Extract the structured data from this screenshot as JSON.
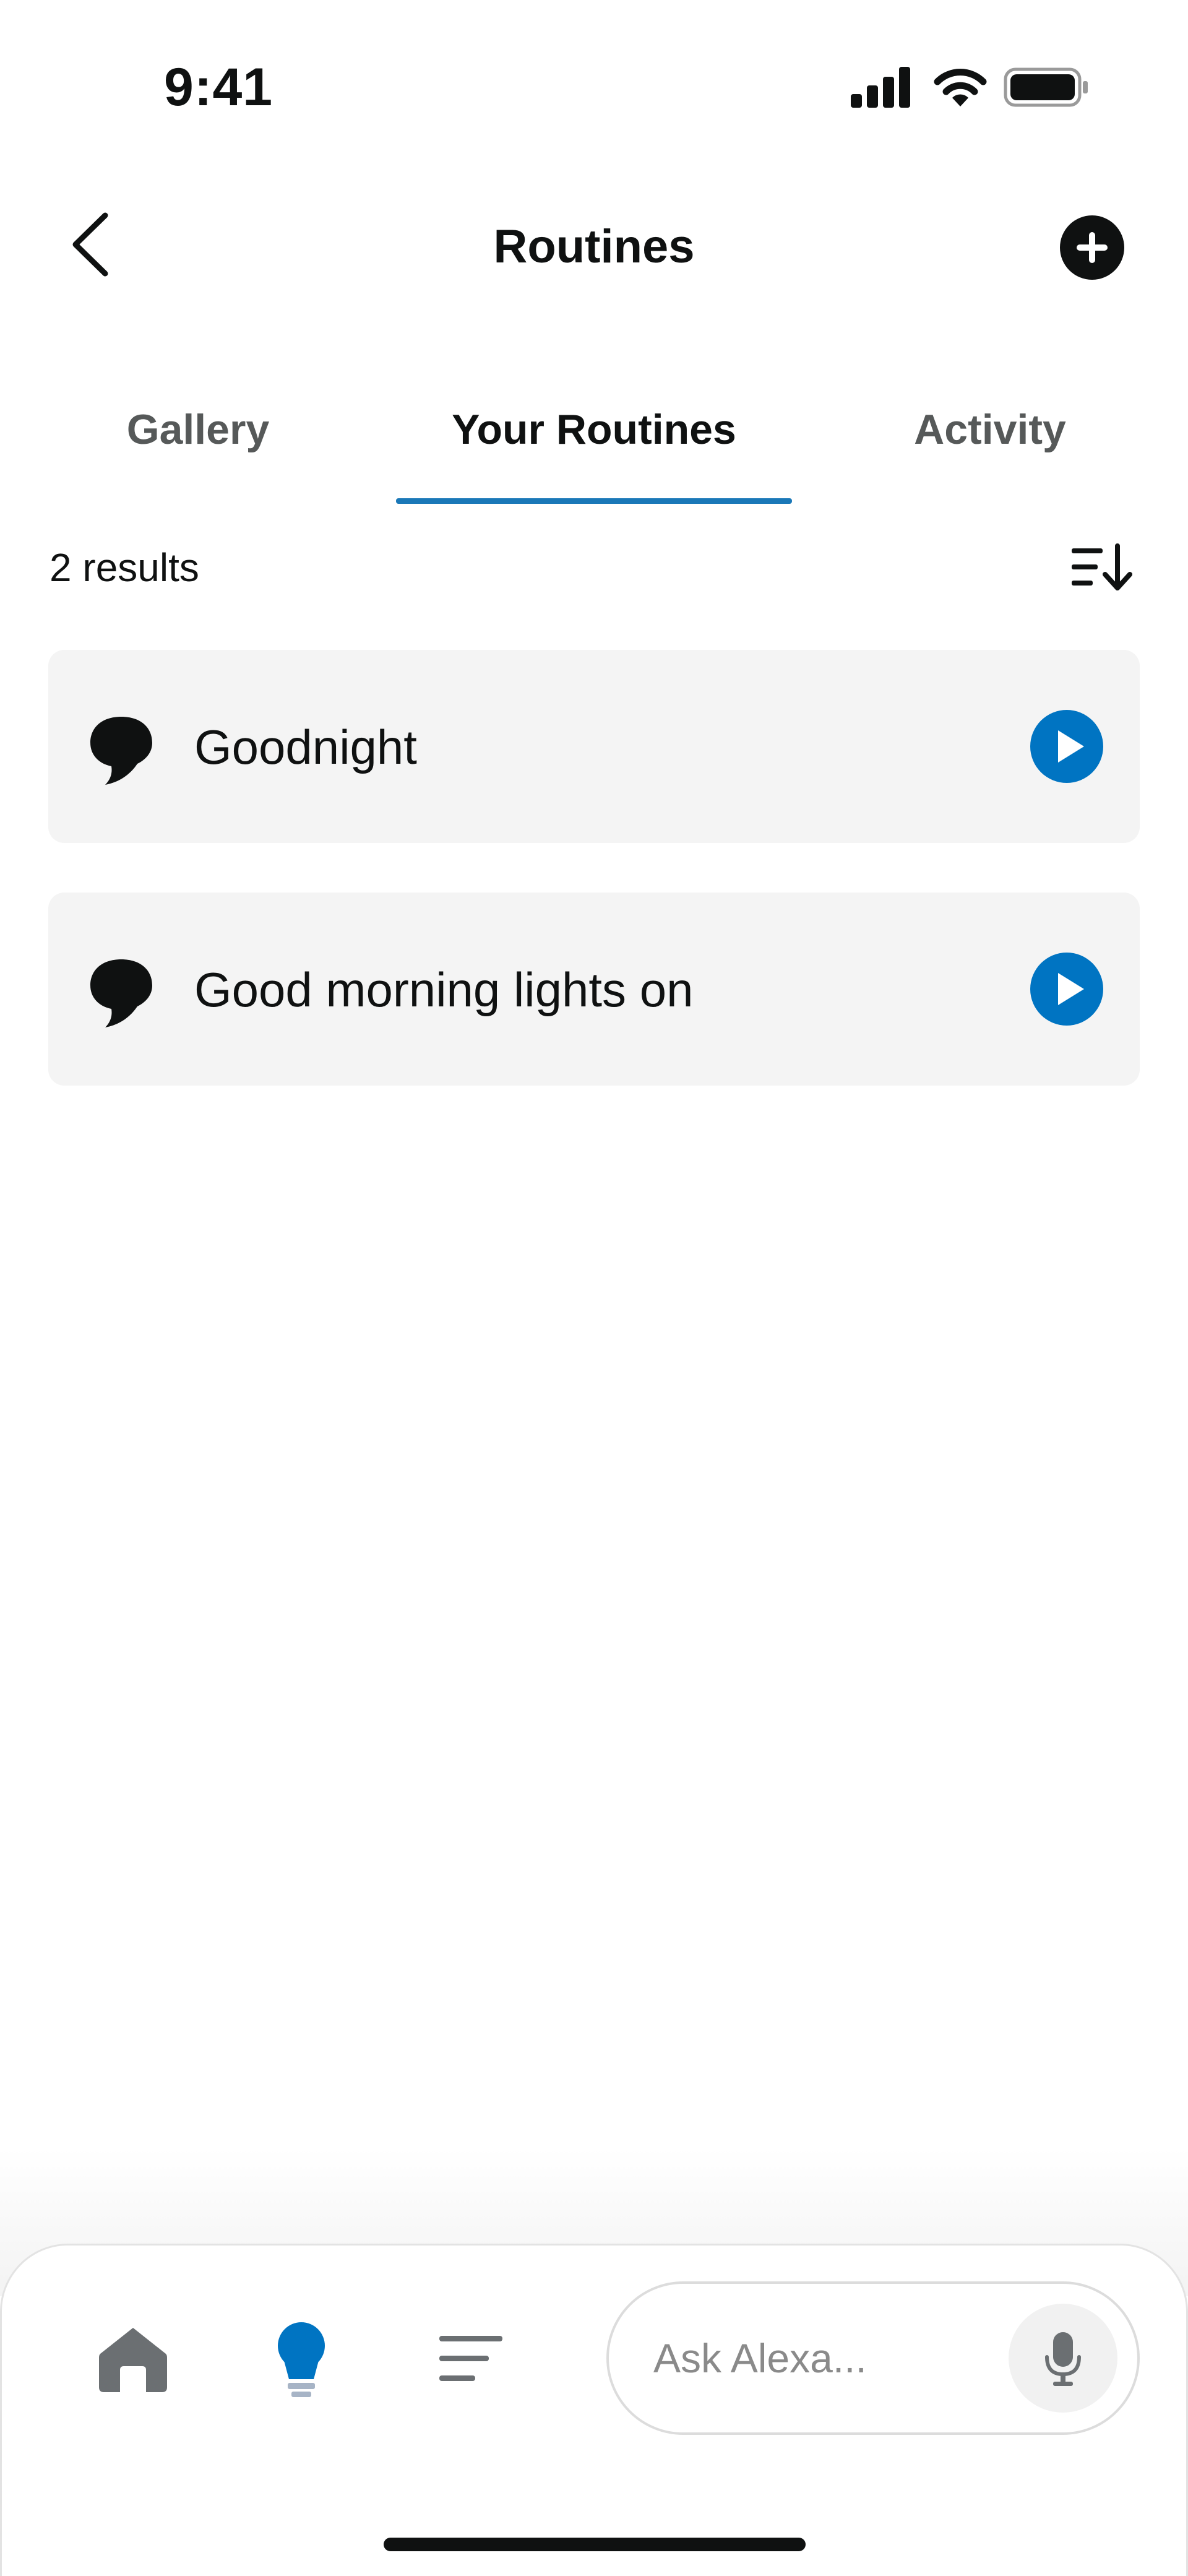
{
  "status_bar": {
    "time": "9:41"
  },
  "header": {
    "title": "Routines"
  },
  "tabs": [
    {
      "label": "Gallery",
      "active": false
    },
    {
      "label": "Your Routines",
      "active": true
    },
    {
      "label": "Activity",
      "active": false
    }
  ],
  "results": {
    "count_text": "2 results"
  },
  "routines": [
    {
      "name": "Goodnight"
    },
    {
      "name": "Good morning lights on"
    }
  ],
  "bottom_bar": {
    "nav": [
      {
        "icon": "home-icon",
        "active": false
      },
      {
        "icon": "lightbulb-icon",
        "active": true
      },
      {
        "icon": "menu-lines-icon",
        "active": false
      }
    ],
    "ask_placeholder": "Ask Alexa..."
  },
  "colors": {
    "accent": "#1a78b8",
    "play_button": "#0074c2",
    "card_bg": "#f4f4f4",
    "text": "#0f1111",
    "muted": "#565959"
  }
}
